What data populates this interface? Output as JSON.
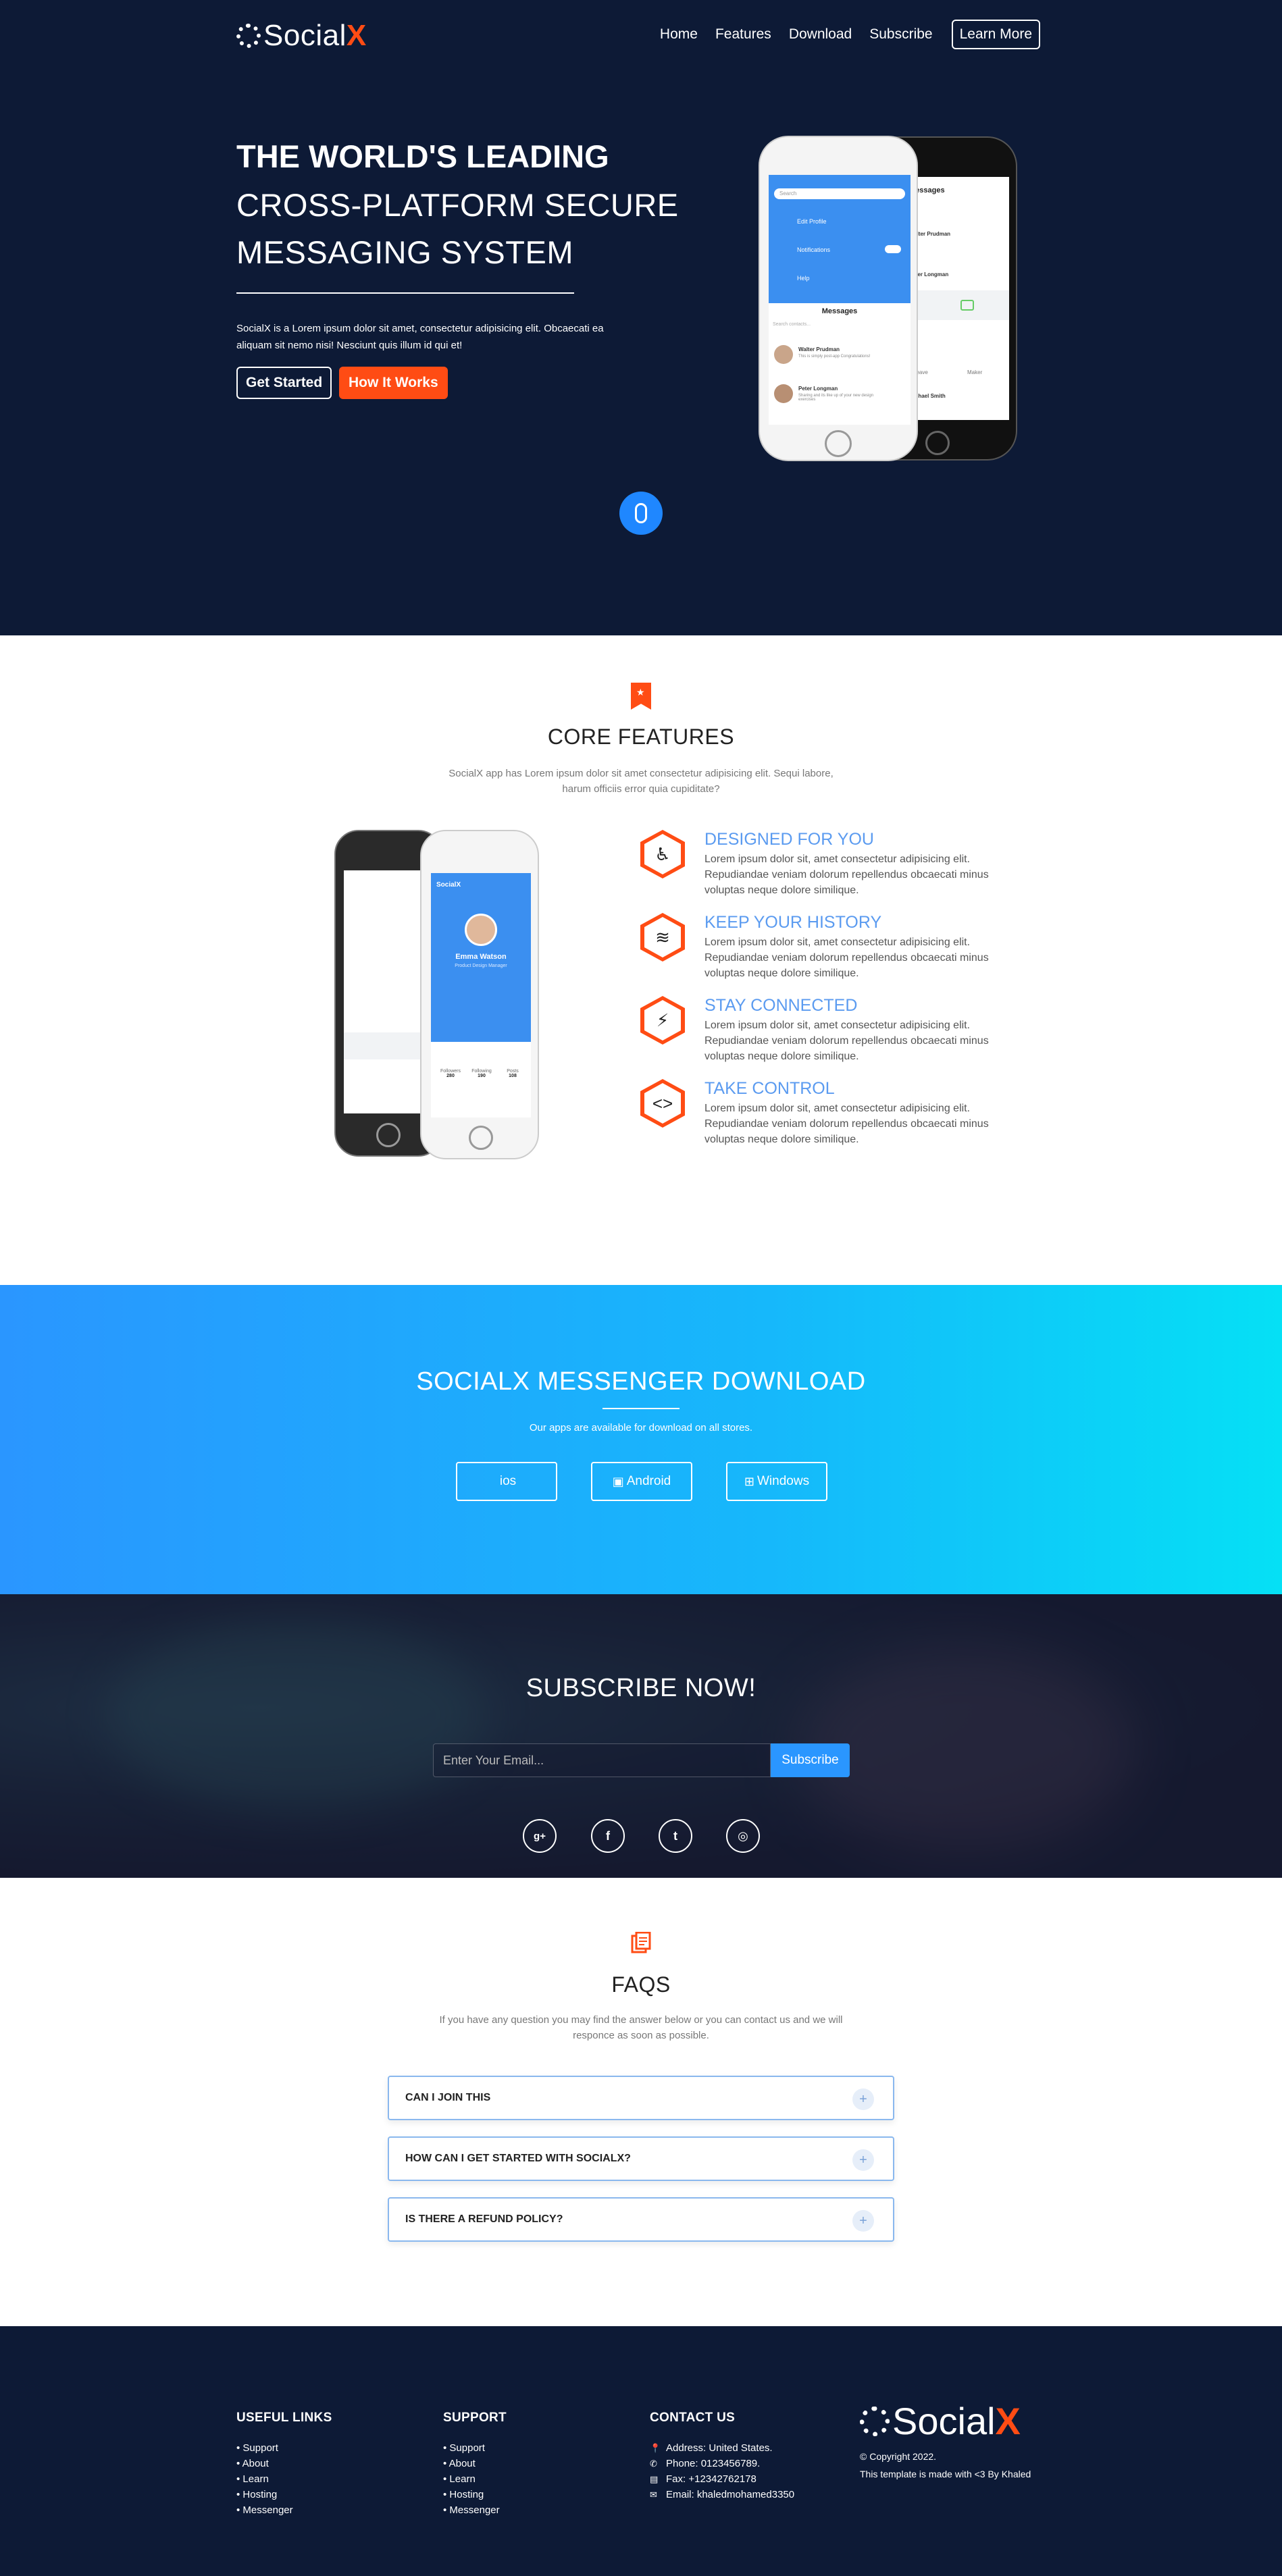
{
  "brand": {
    "name": "Social",
    "accent": "X",
    "accent_color": "#ff4c14",
    "bg_color": "#0d1a36"
  },
  "nav": {
    "items": [
      "Home",
      "Features",
      "Download",
      "Subscribe"
    ],
    "cta": "Learn More"
  },
  "hero": {
    "title_bold": "THE WORLD'S LEADING",
    "title_line2": "CROSS-PLATFORM SECURE",
    "title_line3": "MESSAGING SYSTEM",
    "text": "SocialX is a Lorem ipsum dolor sit amet, consectetur adipisicing elit. Obcaecati ea aliquam sit nemo nisi! Nesciunt quis illum id qui et!",
    "btn_start": "Get Started",
    "btn_how": "How It Works",
    "phone": {
      "search": "Search",
      "menu": [
        "Edit Profile",
        "Notifications",
        "Help"
      ],
      "messages_title": "Messages",
      "search_contacts": "Search contacts...",
      "contacts": [
        {
          "name": "Walter Prudman",
          "msg": "This is simply post-app Congratulations!"
        },
        {
          "name": "Peter Longman",
          "msg": "Sharing and its like up of your new design exercises"
        }
      ],
      "back_messages_title": "Messages",
      "back_contacts": [
        "Walter Prudman",
        "Peter Longman",
        "Michael Smith"
      ],
      "back_tabs": [
        "Leave",
        "Maker"
      ]
    }
  },
  "features": {
    "title": "CORE FEATURES",
    "subtitle": "SocialX app has Lorem ipsum dolor sit amet consectetur adipisicing elit. Sequi labore, harum officiis error quia cupiditate?",
    "items": [
      {
        "title": "DESIGNED FOR YOU",
        "text": "Lorem ipsum dolor sit, amet consectetur adipisicing elit. Repudiandae veniam dolorum repellendus obcaecati minus voluptas neque dolore similique.",
        "icon": "wheelchair-icon"
      },
      {
        "title": "KEEP YOUR HISTORY",
        "text": "Lorem ipsum dolor sit, amet consectetur adipisicing elit. Repudiandae veniam dolorum repellendus obcaecati minus voluptas neque dolore similique.",
        "icon": "layers-icon"
      },
      {
        "title": "STAY CONNECTED",
        "text": "Lorem ipsum dolor sit, amet consectetur adipisicing elit. Repudiandae veniam dolorum repellendus obcaecati minus voluptas neque dolore similique.",
        "icon": "plug-icon"
      },
      {
        "title": "TAKE CONTROL",
        "text": "Lorem ipsum dolor sit, amet consectetur adipisicing elit. Repudiandae veniam dolorum repellendus obcaecati minus voluptas neque dolore similique.",
        "icon": "code-icon"
      }
    ],
    "profile_phone": {
      "app_name": "SocialX",
      "user_name": "Emma Watson",
      "user_role": "Product Design Manager",
      "stats": [
        {
          "label": "Followers",
          "value": "280"
        },
        {
          "label": "Following",
          "value": "190"
        },
        {
          "label": "Posts",
          "value": "108"
        }
      ]
    }
  },
  "download": {
    "title": "SOCIALX MESSENGER DOWNLOAD",
    "subtitle": "Our apps are available for download on all stores.",
    "buttons": [
      {
        "label": "ios",
        "icon": "apple-icon"
      },
      {
        "label": "Android",
        "icon": "android-icon"
      },
      {
        "label": "Windows",
        "icon": "windows-icon"
      }
    ]
  },
  "subscribe": {
    "title": "SUBSCRIBE NOW!",
    "placeholder": "Enter Your Email...",
    "button": "Subscribe",
    "social": [
      {
        "name": "google-plus-icon",
        "glyph": "g+"
      },
      {
        "name": "facebook-icon",
        "glyph": "f"
      },
      {
        "name": "twitter-icon",
        "glyph": "t"
      },
      {
        "name": "instagram-icon",
        "glyph": "◎"
      }
    ]
  },
  "faq": {
    "title": "FAQS",
    "subtitle": "If you have any question you may find the answer below or you can contact us and we will responce as soon as possible.",
    "items": [
      "CAN I JOIN THIS",
      "HOW CAN I GET STARTED WITH SOCIALX?",
      "IS THERE A REFUND POLICY?"
    ]
  },
  "footer": {
    "useful_links": {
      "title": "USEFUL LINKS",
      "items": [
        "• Support",
        "• About",
        "• Learn",
        "• Hosting",
        "• Messenger"
      ]
    },
    "support": {
      "title": "SUPPORT",
      "items": [
        "• Support",
        "• About",
        "• Learn",
        "• Hosting",
        "• Messenger"
      ]
    },
    "contact": {
      "title": "CONTACT US",
      "items": [
        {
          "icon": "map-pin-icon",
          "text": "Address: United States."
        },
        {
          "icon": "phone-icon",
          "text": "Phone: 0123456789."
        },
        {
          "icon": "fax-icon",
          "text": "Fax: +12342762178"
        },
        {
          "icon": "envelope-icon",
          "text": "Email: khaledmohamed3350"
        }
      ]
    },
    "copyright": "© Copyright 2022.",
    "made_with": "This template is made with <3 By Khaled"
  }
}
